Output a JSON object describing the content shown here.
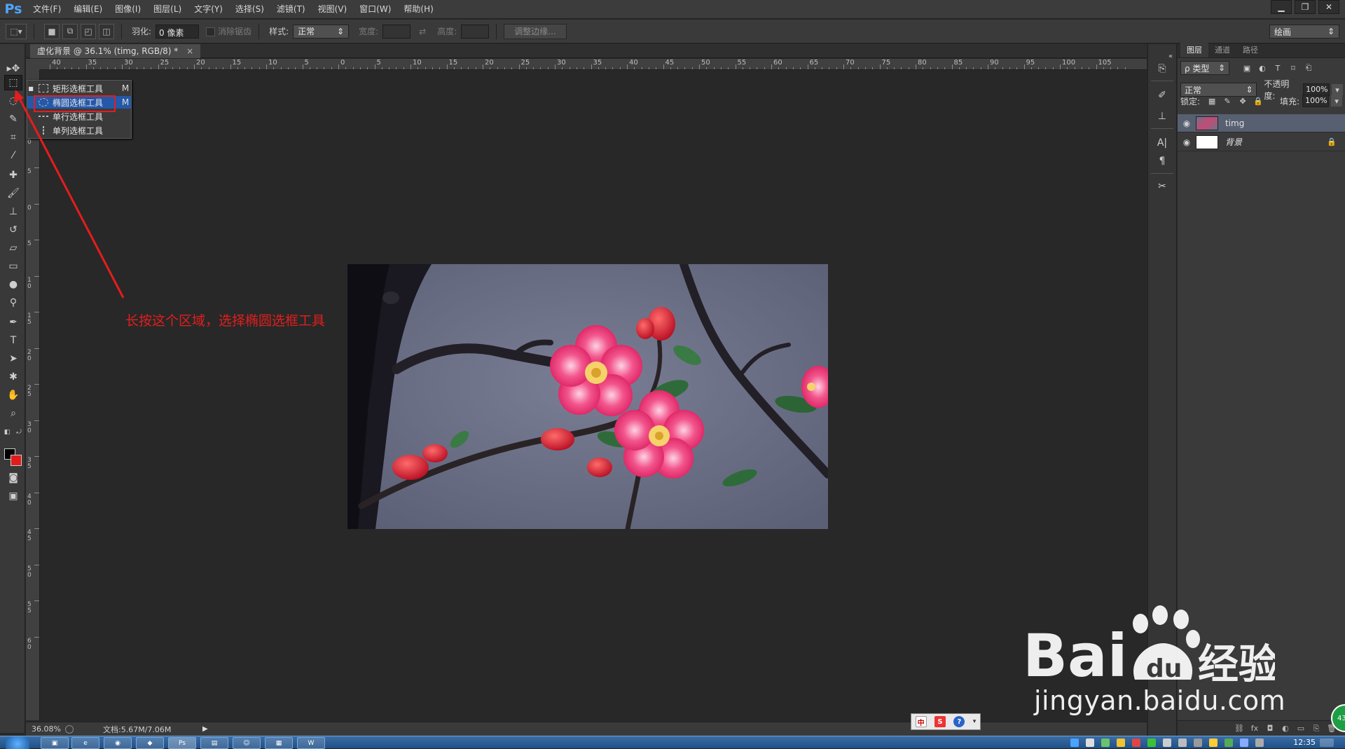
{
  "app": {
    "logo": "Ps",
    "menu": [
      "文件(F)",
      "编辑(E)",
      "图像(I)",
      "图层(L)",
      "文字(Y)",
      "选择(S)",
      "滤镜(T)",
      "视图(V)",
      "窗口(W)",
      "帮助(H)"
    ],
    "window_controls": [
      "▁",
      "❐",
      "✕"
    ]
  },
  "options": {
    "feather_label": "羽化:",
    "feather_value": "0 像素",
    "antialias_label": "消除锯齿",
    "style_label": "样式:",
    "style_value": "正常",
    "width_label": "宽度:",
    "height_label": "高度:",
    "refine_button": "调整边缘...",
    "workspace": "绘画"
  },
  "document": {
    "tab_title": "虚化背景 @ 36.1% (timg, RGB/8) *",
    "tab_close": "×",
    "zoom": "36.08%",
    "doc_size": "文档:5.67M/7.06M"
  },
  "ruler": {
    "top": [
      "40",
      "35",
      "30",
      "25",
      "20",
      "15",
      "10",
      "5",
      "0",
      "5",
      "10",
      "15",
      "20",
      "25",
      "30",
      "35",
      "40",
      "45",
      "50",
      "55",
      "60",
      "65",
      "70",
      "75",
      "80",
      "85",
      "90",
      "95",
      "100",
      "105"
    ],
    "left": [
      "1\n5",
      "1\n0",
      "5",
      "0",
      "5",
      "1\n0",
      "1\n5",
      "2\n0",
      "2\n5",
      "3\n0",
      "3\n5",
      "4\n0",
      "4\n5",
      "5\n0",
      "5\n5",
      "6\n0"
    ]
  },
  "flyout": {
    "items": [
      {
        "label": "矩形选框工具",
        "key": "M",
        "icon": "rect-marquee-icon"
      },
      {
        "label": "椭圆选框工具",
        "key": "M",
        "icon": "ellipse-marquee-icon"
      },
      {
        "label": "单行选框工具",
        "key": "",
        "icon": "single-row-marquee-icon"
      },
      {
        "label": "单列选框工具",
        "key": "",
        "icon": "single-column-marquee-icon"
      }
    ]
  },
  "annotation": {
    "text": "长按这个区域，选择椭圆选框工具",
    "color": "#e41d1d"
  },
  "layers_panel": {
    "tabs": [
      "图层",
      "通道",
      "路径"
    ],
    "filter_kind": "ρ 类型",
    "blend_mode": "正常",
    "opacity_label": "不透明度:",
    "opacity_value": "100%",
    "lock_label": "锁定:",
    "fill_label": "填充:",
    "fill_value": "100%",
    "layers": [
      {
        "name": "timg",
        "selected": true
      },
      {
        "name": "背景",
        "selected": false,
        "locked": true
      }
    ]
  },
  "ime": {
    "buttons": [
      "中",
      "S",
      "?"
    ]
  },
  "taskbar": {
    "clock": "12:35"
  },
  "watermark": {
    "brand": "Baidu经验",
    "url": "jingyan.baidu.com"
  },
  "badge": "43"
}
